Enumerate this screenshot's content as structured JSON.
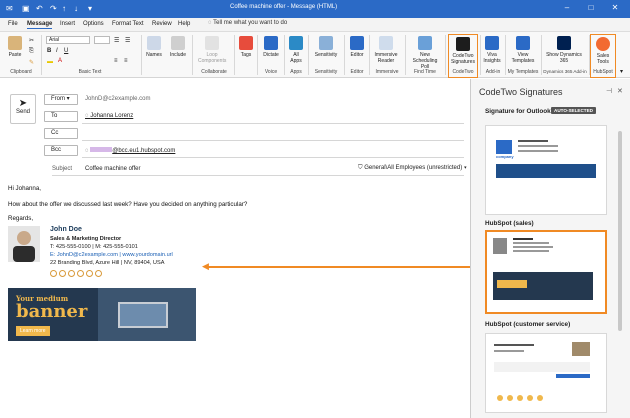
{
  "titlebar": {
    "title": "Coffee machine offer - Message (HTML)"
  },
  "menu": {
    "items": [
      "File",
      "Message",
      "Insert",
      "Options",
      "Format Text",
      "Review",
      "Help"
    ],
    "tell_me": "Tell me what you want to do"
  },
  "ribbon": {
    "paste": "Paste",
    "font_name": "Arial",
    "names": "Names",
    "include": "Include",
    "loop": "Loop Components",
    "tags": "Tags",
    "dictate": "Dictate",
    "all_apps": "All Apps",
    "sensitivity": "Sensitivity",
    "editor": "Editor",
    "immersive": "Immersive Reader",
    "new_poll": "New Scheduling Poll",
    "codetwo": "CodeTwo Signatures",
    "viva": "Viva Insights",
    "view_templates": "View Templates",
    "show_dynamics": "Show Dynamics 365",
    "sales_tools": "Sales Tools",
    "groups": {
      "clipboard": "Clipboard",
      "basic_text": "Basic Text",
      "collaborate": "Collaborate",
      "voice": "Voice",
      "apps": "Apps",
      "sensitivity": "Sensitivity",
      "editor": "Editor",
      "immersive": "Immersive",
      "find_time": "Find Time",
      "codetwo": "CodeTwo",
      "addin": "Add-in",
      "my_templates": "My Templates",
      "dynamics": "Dynamics 365 Add-in",
      "hubspot": "HubSpot"
    }
  },
  "compose": {
    "send": "Send",
    "from_label": "From",
    "from_value": "JohnD@c2example.com",
    "to_label": "To",
    "to_value": "Johanna Lorenz",
    "cc_label": "Cc",
    "bcc_label": "Bcc",
    "bcc_value": "@bcc.eu1.hubspot.com",
    "subject_label": "Subject",
    "subject_value": "Coffee machine offer",
    "label": "General\\All Employees (unrestricted)"
  },
  "body": {
    "greeting": "Hi Johanna,",
    "line1": "How about the offer we discussed last week? Have you decided on anything particular?",
    "regards": "Regards,"
  },
  "signature": {
    "name": "John Doe",
    "title": "Sales & Marketing Director",
    "phones": "T: 425-555-0100 | M: 425-555-0101",
    "email": "E: JohnD@c2example.com | www.yourdomain.url",
    "address": "22 Branding Blvd, Azure Hill | NV, 89404, USA",
    "banner_top": "Your medium",
    "banner_main": "banner",
    "banner_btn": "Learn more"
  },
  "pane": {
    "title": "CodeTwo Signatures",
    "sections": [
      {
        "name": "Signature for Outlook",
        "badge": "AUTO-SELECTED"
      },
      {
        "name": "HubSpot (sales)"
      },
      {
        "name": "HubSpot (customer service)"
      }
    ],
    "card1_company": "company"
  },
  "colors": {
    "titlebar": "#2b6ac6",
    "accent": "#f08a24",
    "link": "#1a5fb4"
  }
}
